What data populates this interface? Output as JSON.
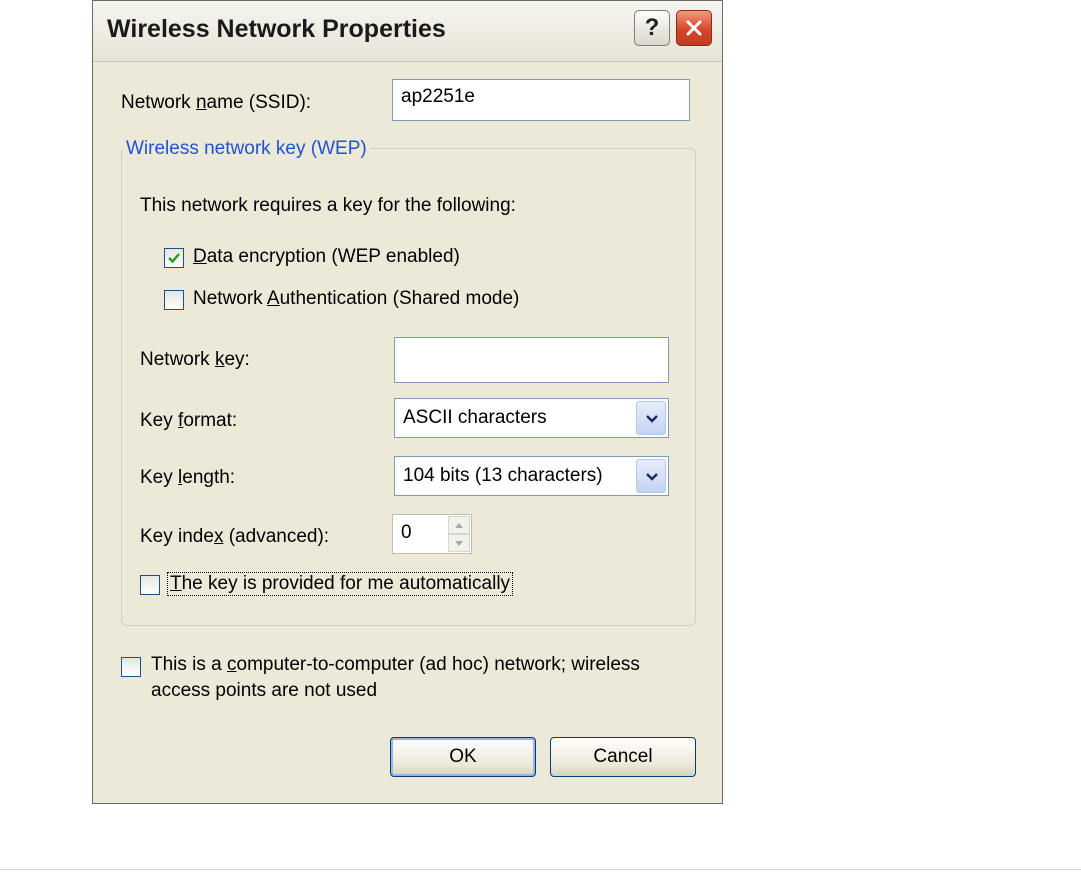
{
  "window": {
    "title": "Wireless Network Properties",
    "help_glyph": "?",
    "close_icon": "close-x-icon"
  },
  "ssid": {
    "label_pre": "Network ",
    "label_key": "n",
    "label_post": "ame (SSID):",
    "value": "ap2251e"
  },
  "wep_group": {
    "legend": "Wireless network key (WEP)",
    "intro": "This network requires a key for the following:",
    "data_encryption": {
      "key": "D",
      "rest": "ata encryption (WEP enabled)",
      "checked": true
    },
    "network_auth": {
      "pre": "Network ",
      "key": "A",
      "rest": "uthentication (Shared mode)",
      "checked": false
    },
    "network_key": {
      "pre": "Network ",
      "key": "k",
      "post": "ey:",
      "value": ""
    },
    "key_format": {
      "pre": "Key ",
      "key": "f",
      "post": "ormat:",
      "value": "ASCII characters"
    },
    "key_length": {
      "pre": "Key ",
      "key": "l",
      "post": "ength:",
      "value": "104 bits (13 characters)"
    },
    "key_index": {
      "pre": "Key inde",
      "key": "x",
      "post": " (advanced):",
      "value": "0"
    },
    "auto_key": {
      "key": "T",
      "rest": "he key is provided for me automatically",
      "checked": false
    }
  },
  "adhoc": {
    "pre": "This is a ",
    "key": "c",
    "line1_post": "omputer-to-computer (ad hoc) network; wireless",
    "line2": "access points are not used",
    "checked": false
  },
  "buttons": {
    "ok": "OK",
    "cancel": "Cancel"
  },
  "colors": {
    "dialog_bg": "#ece9d8",
    "legend_blue": "#2152d6",
    "check_green": "#21a121",
    "close_red": "#d8452a"
  }
}
